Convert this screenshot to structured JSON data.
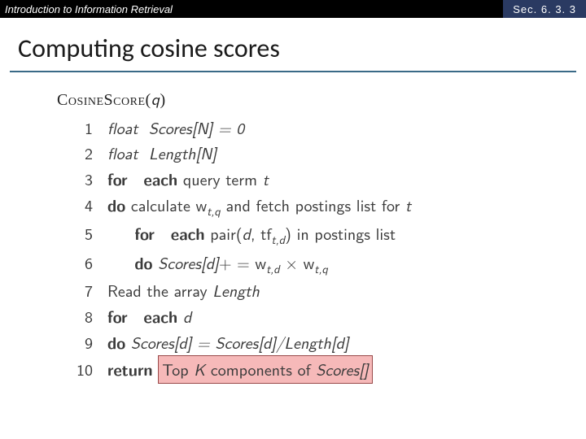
{
  "topbar": {
    "title": "Introduction to Information Retrieval",
    "section": "Sec. 6. 3. 3"
  },
  "heading": "Computing cosine scores",
  "algo": {
    "name_sc": "CosineScore",
    "name_arg": "q",
    "lines": {
      "1": {
        "n": "1",
        "kw1": "",
        "text": "float",
        "rest": "Scores[N] = 0"
      },
      "2": {
        "n": "2",
        "kw1": "",
        "text": "float",
        "rest": "Length[N]"
      },
      "3": {
        "n": "3",
        "kw1": "for",
        "kw2": "each",
        "rest": " query term ",
        "tail_it": "t"
      },
      "4": {
        "n": "4",
        "kw1": "do",
        "rest": " calculate w",
        "sub": "t,q",
        "rest2": " and fetch postings list for ",
        "tail_it": "t"
      },
      "5": {
        "n": "5",
        "kw1": "for",
        "kw2": "each",
        "rest": " pair(",
        "it1": "d",
        "mid": ", tf",
        "sub": "t,d",
        "rest2": ") in postings list"
      },
      "6": {
        "n": "6",
        "kw1": "do",
        "it1": "Scores[d]",
        "rest": "+ = w",
        "sub": "t,d",
        "mid": " × w",
        "sub2": "t,q"
      },
      "7": {
        "n": "7",
        "rest": "Read the array ",
        "it1": "Length"
      },
      "8": {
        "n": "8",
        "kw1": "for",
        "kw2": "each",
        "rest": " ",
        "it1": "d"
      },
      "9": {
        "n": "9",
        "kw1": "do",
        "it1": "Scores[d] = Scores[d]/Length[d]"
      },
      "10": {
        "n": "10",
        "kw1": "return",
        "hl_pre": "Top ",
        "hl_it": "K",
        "hl_mid": " components of ",
        "hl_it2": "Scores[]"
      }
    }
  }
}
